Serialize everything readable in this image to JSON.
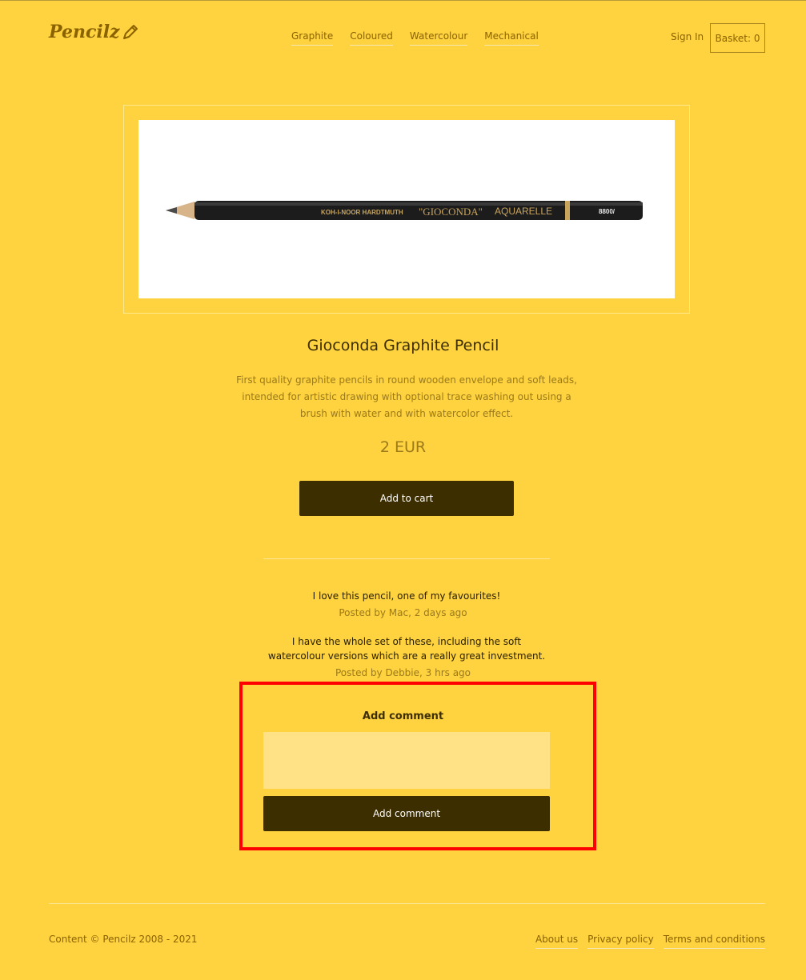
{
  "header": {
    "logo_text": "Pencilz",
    "logo_icon": "pencil-icon",
    "nav": [
      {
        "label": "Graphite"
      },
      {
        "label": "Coloured"
      },
      {
        "label": "Watercolour"
      },
      {
        "label": "Mechanical"
      }
    ],
    "sign_in": "Sign In",
    "basket": "Basket: 0"
  },
  "product": {
    "image_label_brand": "KOH-I-NOOR HARDTMUTH",
    "image_label_name": "\"GIOCONDA\"",
    "image_label_type": "AQUARELLE",
    "image_label_code": "8800/",
    "title": "Gioconda Graphite Pencil",
    "description": "First quality graphite pencils in round wooden envelope and soft leads, intended for artistic drawing with optional trace washing out using a brush with water and with watercolor effect.",
    "price": "2 EUR",
    "add_to_cart_label": "Add to cart"
  },
  "comments": [
    {
      "text": "I love this pencil, one of my favourites!",
      "meta": "Posted by Mac, 2 days ago"
    },
    {
      "text": "I have the whole set of these, including the soft watercolour versions which are a really great investment.",
      "meta": "Posted by Debbie, 3 hrs ago"
    }
  ],
  "comment_form": {
    "heading": "Add comment",
    "input_value": "",
    "submit_label": "Add comment"
  },
  "footer": {
    "copyright": "Content © Pencilz 2008 - 2021",
    "links": [
      {
        "label": "About us"
      },
      {
        "label": "Privacy policy"
      },
      {
        "label": "Terms and conditions"
      }
    ]
  },
  "colors": {
    "background": "#ffd23f",
    "button": "#3d2e00",
    "highlight": "#ff0000"
  }
}
